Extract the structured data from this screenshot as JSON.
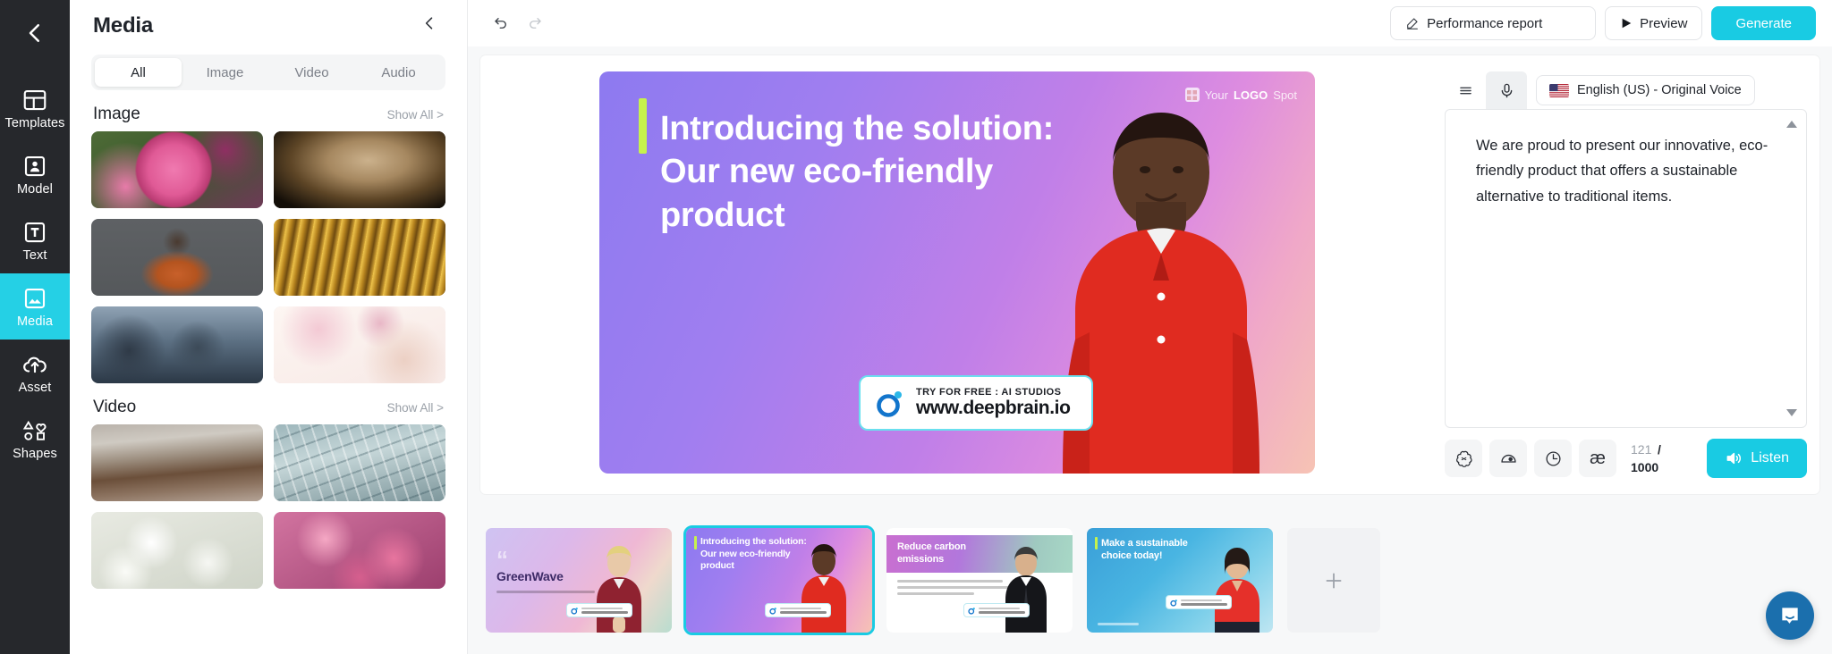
{
  "rail": {
    "back_icon": "chevron-left-icon",
    "items": [
      {
        "label": "Templates",
        "icon": "templates-icon",
        "active": false
      },
      {
        "label": "Model",
        "icon": "model-person-icon",
        "active": false
      },
      {
        "label": "Text",
        "icon": "text-t-icon",
        "active": false
      },
      {
        "label": "Media",
        "icon": "media-image-icon",
        "active": true
      },
      {
        "label": "Asset",
        "icon": "asset-upload-cloud-icon",
        "active": false
      },
      {
        "label": "Shapes",
        "icon": "shapes-icon",
        "active": false
      }
    ],
    "active_color": "#25D0E5"
  },
  "panel": {
    "title": "Media",
    "collapse_icon": "chevron-left-icon",
    "tabs": [
      {
        "label": "All",
        "active": true
      },
      {
        "label": "Image",
        "active": false
      },
      {
        "label": "Video",
        "active": false
      },
      {
        "label": "Audio",
        "active": false
      }
    ],
    "sections": [
      {
        "title": "Image",
        "show_all": "Show All >",
        "items": [
          {
            "name": "pink-peony-flower"
          },
          {
            "name": "dark-close-up-texture"
          },
          {
            "name": "woman-orange-blouse-portrait"
          },
          {
            "name": "golden-wheat-field"
          },
          {
            "name": "office-team-at-monitors"
          },
          {
            "name": "pastel-floral-abstract-art"
          }
        ]
      },
      {
        "title": "Video",
        "show_all": "Show All >",
        "items": [
          {
            "name": "ocean-shoreline-waves"
          },
          {
            "name": "airport-terminal-interior"
          },
          {
            "name": "white-blossom-branches"
          },
          {
            "name": "pink-cherry-blossoms"
          }
        ]
      }
    ]
  },
  "topbar": {
    "undo_icon": "undo-arrow-icon",
    "redo_icon": "redo-arrow-icon",
    "performance_report": "Performance report",
    "performance_icon": "pencil-edit-icon",
    "preview": "Preview",
    "preview_icon": "play-triangle-icon",
    "generate": "Generate",
    "accent_color": "#19CBE3"
  },
  "slide": {
    "title": "Introducing the solution:\nOur new eco-friendly product",
    "accent_bar_color": "#c6f24d",
    "logo_spot_prefix": "Your ",
    "logo_spot_bold": "LOGO",
    "logo_spot_suffix": " Spot",
    "cta_small": "TRY FOR FREE : AI STUDIOS",
    "cta_large": "www.deepbrain.io",
    "avatar": "man-in-red-polo-shirt"
  },
  "script": {
    "list_icon": "list-lines-icon",
    "mic_icon": "microphone-icon",
    "language": "English (US) - Original Voice",
    "flag": "us-flag-icon",
    "text": "We are proud to present our innovative, eco-friendly product that offers a sustainable alternative to traditional items.",
    "scroll_up_icon": "triangle-up-icon",
    "scroll_down_icon": "triangle-down-icon",
    "tools": [
      {
        "name": "ai-sparkle-icon"
      },
      {
        "name": "speed-gauge-icon"
      },
      {
        "name": "clock-pause-icon"
      },
      {
        "name": "pronunciation-ae-icon"
      }
    ],
    "char_count": "121",
    "char_separator": "/",
    "char_max": "1000",
    "listen": "Listen",
    "listen_icon": "speaker-volume-icon"
  },
  "filmstrip": {
    "slides": [
      {
        "title": "GreenWave",
        "selected": false,
        "avatar": "woman-in-dark-red-blouse"
      },
      {
        "title": "Introducing the solution:\nOur new eco-friendly product",
        "selected": true,
        "avatar": "man-in-red-polo-shirt"
      },
      {
        "title": "Reduce carbon emissions",
        "selected": false,
        "avatar": "man-in-black-suit"
      },
      {
        "title": "Make a sustainable choice today!",
        "selected": false,
        "avatar": "woman-in-red-top"
      }
    ],
    "add_label": "+",
    "add_icon": "plus-icon",
    "badge_text": "www.deepbrain.io"
  },
  "intercom": {
    "icon": "chat-bubble-icon",
    "color": "#1b6fad"
  }
}
